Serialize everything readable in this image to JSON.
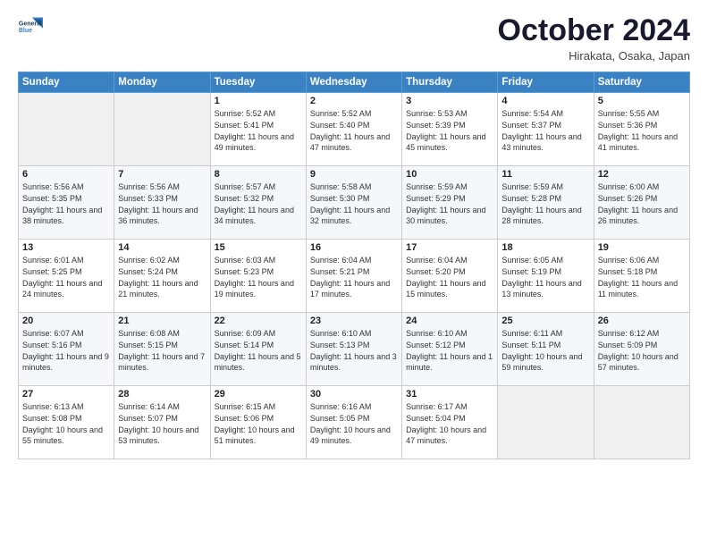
{
  "logo": {
    "line1": "General",
    "line2": "Blue"
  },
  "title": "October 2024",
  "subtitle": "Hirakata, Osaka, Japan",
  "days_of_week": [
    "Sunday",
    "Monday",
    "Tuesday",
    "Wednesday",
    "Thursday",
    "Friday",
    "Saturday"
  ],
  "weeks": [
    [
      {
        "day": "",
        "info": ""
      },
      {
        "day": "",
        "info": ""
      },
      {
        "day": "1",
        "info": "Sunrise: 5:52 AM\nSunset: 5:41 PM\nDaylight: 11 hours and 49 minutes."
      },
      {
        "day": "2",
        "info": "Sunrise: 5:52 AM\nSunset: 5:40 PM\nDaylight: 11 hours and 47 minutes."
      },
      {
        "day": "3",
        "info": "Sunrise: 5:53 AM\nSunset: 5:39 PM\nDaylight: 11 hours and 45 minutes."
      },
      {
        "day": "4",
        "info": "Sunrise: 5:54 AM\nSunset: 5:37 PM\nDaylight: 11 hours and 43 minutes."
      },
      {
        "day": "5",
        "info": "Sunrise: 5:55 AM\nSunset: 5:36 PM\nDaylight: 11 hours and 41 minutes."
      }
    ],
    [
      {
        "day": "6",
        "info": "Sunrise: 5:56 AM\nSunset: 5:35 PM\nDaylight: 11 hours and 38 minutes."
      },
      {
        "day": "7",
        "info": "Sunrise: 5:56 AM\nSunset: 5:33 PM\nDaylight: 11 hours and 36 minutes."
      },
      {
        "day": "8",
        "info": "Sunrise: 5:57 AM\nSunset: 5:32 PM\nDaylight: 11 hours and 34 minutes."
      },
      {
        "day": "9",
        "info": "Sunrise: 5:58 AM\nSunset: 5:30 PM\nDaylight: 11 hours and 32 minutes."
      },
      {
        "day": "10",
        "info": "Sunrise: 5:59 AM\nSunset: 5:29 PM\nDaylight: 11 hours and 30 minutes."
      },
      {
        "day": "11",
        "info": "Sunrise: 5:59 AM\nSunset: 5:28 PM\nDaylight: 11 hours and 28 minutes."
      },
      {
        "day": "12",
        "info": "Sunrise: 6:00 AM\nSunset: 5:26 PM\nDaylight: 11 hours and 26 minutes."
      }
    ],
    [
      {
        "day": "13",
        "info": "Sunrise: 6:01 AM\nSunset: 5:25 PM\nDaylight: 11 hours and 24 minutes."
      },
      {
        "day": "14",
        "info": "Sunrise: 6:02 AM\nSunset: 5:24 PM\nDaylight: 11 hours and 21 minutes."
      },
      {
        "day": "15",
        "info": "Sunrise: 6:03 AM\nSunset: 5:23 PM\nDaylight: 11 hours and 19 minutes."
      },
      {
        "day": "16",
        "info": "Sunrise: 6:04 AM\nSunset: 5:21 PM\nDaylight: 11 hours and 17 minutes."
      },
      {
        "day": "17",
        "info": "Sunrise: 6:04 AM\nSunset: 5:20 PM\nDaylight: 11 hours and 15 minutes."
      },
      {
        "day": "18",
        "info": "Sunrise: 6:05 AM\nSunset: 5:19 PM\nDaylight: 11 hours and 13 minutes."
      },
      {
        "day": "19",
        "info": "Sunrise: 6:06 AM\nSunset: 5:18 PM\nDaylight: 11 hours and 11 minutes."
      }
    ],
    [
      {
        "day": "20",
        "info": "Sunrise: 6:07 AM\nSunset: 5:16 PM\nDaylight: 11 hours and 9 minutes."
      },
      {
        "day": "21",
        "info": "Sunrise: 6:08 AM\nSunset: 5:15 PM\nDaylight: 11 hours and 7 minutes."
      },
      {
        "day": "22",
        "info": "Sunrise: 6:09 AM\nSunset: 5:14 PM\nDaylight: 11 hours and 5 minutes."
      },
      {
        "day": "23",
        "info": "Sunrise: 6:10 AM\nSunset: 5:13 PM\nDaylight: 11 hours and 3 minutes."
      },
      {
        "day": "24",
        "info": "Sunrise: 6:10 AM\nSunset: 5:12 PM\nDaylight: 11 hours and 1 minute."
      },
      {
        "day": "25",
        "info": "Sunrise: 6:11 AM\nSunset: 5:11 PM\nDaylight: 10 hours and 59 minutes."
      },
      {
        "day": "26",
        "info": "Sunrise: 6:12 AM\nSunset: 5:09 PM\nDaylight: 10 hours and 57 minutes."
      }
    ],
    [
      {
        "day": "27",
        "info": "Sunrise: 6:13 AM\nSunset: 5:08 PM\nDaylight: 10 hours and 55 minutes."
      },
      {
        "day": "28",
        "info": "Sunrise: 6:14 AM\nSunset: 5:07 PM\nDaylight: 10 hours and 53 minutes."
      },
      {
        "day": "29",
        "info": "Sunrise: 6:15 AM\nSunset: 5:06 PM\nDaylight: 10 hours and 51 minutes."
      },
      {
        "day": "30",
        "info": "Sunrise: 6:16 AM\nSunset: 5:05 PM\nDaylight: 10 hours and 49 minutes."
      },
      {
        "day": "31",
        "info": "Sunrise: 6:17 AM\nSunset: 5:04 PM\nDaylight: 10 hours and 47 minutes."
      },
      {
        "day": "",
        "info": ""
      },
      {
        "day": "",
        "info": ""
      }
    ]
  ]
}
